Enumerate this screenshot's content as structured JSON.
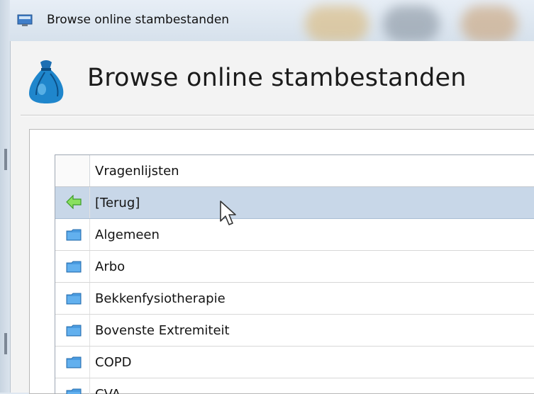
{
  "window": {
    "title": "Browse online stambestanden"
  },
  "header": {
    "title": "Browse online stambestanden"
  },
  "grid": {
    "column_header": "Vragenlijsten",
    "rows": [
      {
        "label": "[Terug]",
        "icon": "back-arrow-icon",
        "selected": true
      },
      {
        "label": "Algemeen",
        "icon": "folder-icon"
      },
      {
        "label": "Arbo",
        "icon": "folder-icon"
      },
      {
        "label": "Bekkenfysiotherapie",
        "icon": "folder-icon"
      },
      {
        "label": "Bovenste Extremiteit",
        "icon": "folder-icon"
      },
      {
        "label": "COPD",
        "icon": "folder-icon"
      },
      {
        "label": "CVA",
        "icon": "folder-icon"
      }
    ]
  },
  "colors": {
    "selection": "#c8d7e8",
    "folder": "#3d8fd6",
    "back_arrow": "#7ed957"
  }
}
